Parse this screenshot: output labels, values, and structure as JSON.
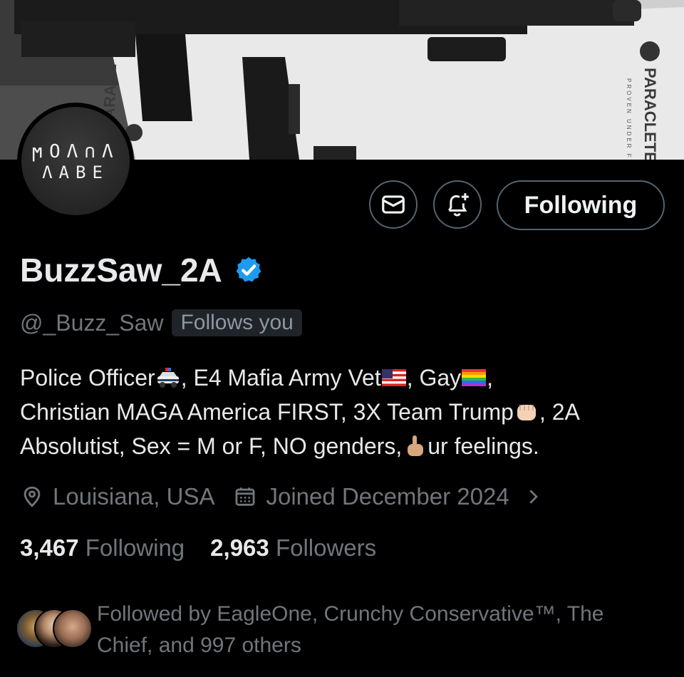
{
  "profile": {
    "display_name": "BuzzSaw_2A",
    "handle": "@_Buzz_Saw",
    "follows_you": "Follows you",
    "avatar_line1": "ϻOΛ∩Λ",
    "avatar_line2": "ΛABE",
    "verified": true
  },
  "banner": {
    "text_left": "PARACL",
    "text_right": "PARACLETE",
    "subtext_right": "PROVEN UNDER FIRE"
  },
  "actions": {
    "message_icon": "envelope-icon",
    "notify_icon": "bell-plus-icon",
    "follow_label": "Following"
  },
  "bio": {
    "part1": "Police Officer",
    "part2": ", E4 Mafia Army Vet",
    "part3": ", Gay",
    "part4": ",",
    "part5": "Christian MAGA America FIRST, 3X Team Trump",
    "part6": ", 2A",
    "part7": "Absolutist, Sex = M or F, NO genders,",
    "part8": "ur feelings.",
    "emojis": [
      "police-car-emoji",
      "us-flag-emoji",
      "rainbow-flag-emoji",
      "fist-emoji",
      "middle-finger-emoji"
    ]
  },
  "meta": {
    "location": "Louisiana, USA",
    "joined": "Joined December 2024",
    "location_icon": "location-pin-icon",
    "calendar_icon": "calendar-icon",
    "chevron_icon": "chevron-right-icon"
  },
  "stats": {
    "following_count": "3,467",
    "following_label": "Following",
    "followers_count": "2,963",
    "followers_label": "Followers"
  },
  "followed_by": {
    "line1": "Followed by EagleOne, Crunchy Conservative™, The",
    "line2": "Chief, and 997 others"
  },
  "colors": {
    "background": "#000000",
    "text_primary": "#e7e9ea",
    "text_secondary": "#71767b",
    "border": "#536471",
    "verified_blue": "#1d9bf0"
  }
}
